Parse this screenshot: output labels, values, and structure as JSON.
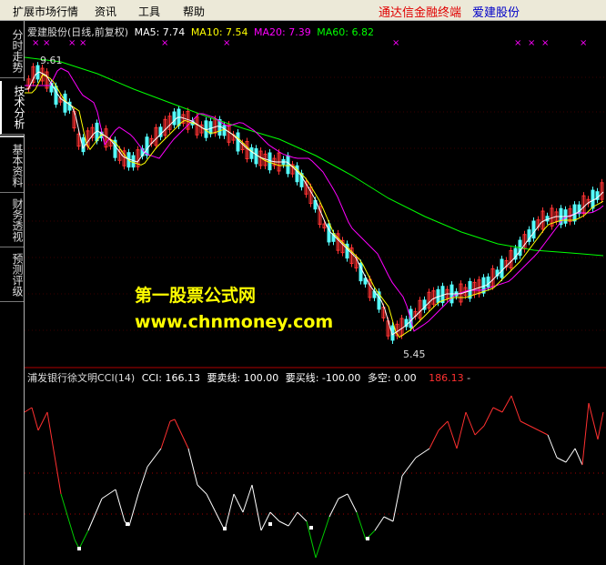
{
  "menu": {
    "items": [
      {
        "label": "扩展市场行情"
      },
      {
        "label": "资讯"
      },
      {
        "label": "工具"
      },
      {
        "label": "帮助"
      }
    ],
    "brand_left": "通达信金融终端",
    "brand_right": "爱建股份"
  },
  "side_tabs": [
    {
      "label": "分时走势"
    },
    {
      "label": "技术分析"
    },
    {
      "label": "基本资料"
    },
    {
      "label": "财务透视"
    },
    {
      "label": "预测评级"
    }
  ],
  "price_panel": {
    "title": "爱建股份(日线,前复权)",
    "ma5": "MA5: 7.74",
    "ma10": "MA10: 7.54",
    "ma20": "MA20: 7.39",
    "ma60": "MA60: 6.82",
    "high_label": "9.61",
    "low_label": "5.45",
    "colors": {
      "ma5": "#ffffff",
      "ma10": "#ffff00",
      "ma20": "#ff00ff",
      "ma60": "#00ff00",
      "up": "#ff3232",
      "down": "#54fcfc"
    }
  },
  "indicator_panel": {
    "title": "浦发银行徐文明CCI(14)",
    "cci": "CCI: 166.13",
    "sell_line": "要卖线: 100.00",
    "buy_line": "要买线: -100.00",
    "long_short": "多空: 0.00",
    "value_red": "186.13",
    "dash": "-"
  },
  "watermark": {
    "line1": "第一股票公式网",
    "line2": "www.chnmoney.com"
  }
}
